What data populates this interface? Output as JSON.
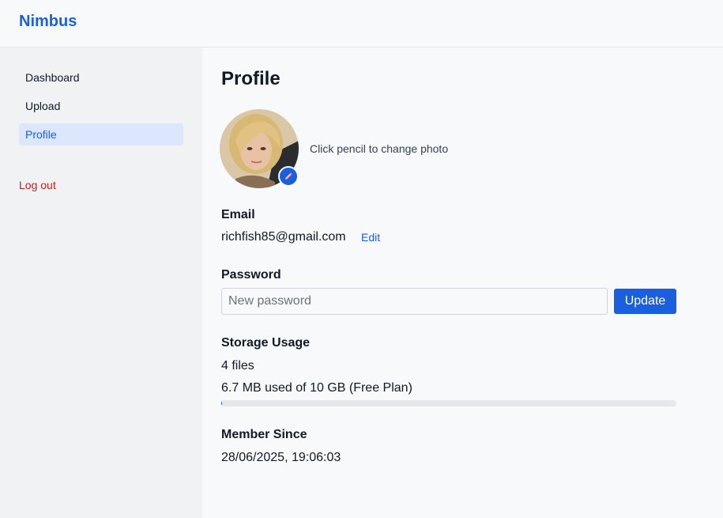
{
  "app": {
    "brand": "Nimbus"
  },
  "sidebar": {
    "items": [
      {
        "label": "Dashboard",
        "active": false
      },
      {
        "label": "Upload",
        "active": false
      },
      {
        "label": "Profile",
        "active": true
      }
    ],
    "logout_label": "Log out"
  },
  "profile": {
    "title": "Profile",
    "photo_hint": "Click pencil to change photo",
    "pencil_icon": "pencil-icon",
    "email_label": "Email",
    "email_value": "richfish85@gmail.com",
    "email_edit_label": "Edit",
    "password_label": "Password",
    "password_placeholder": "New password",
    "password_value": "",
    "update_label": "Update",
    "storage_label": "Storage Usage",
    "files_count": "4",
    "files_suffix": " files",
    "usage_text": "6.7 MB used of 10 GB (Free Plan)",
    "usage_fraction": 0.00067,
    "member_since_label": "Member Since",
    "member_since_value": "28/06/2025, 19:06:03"
  },
  "colors": {
    "accent": "#1a5fe0",
    "danger": "#c81e1e",
    "active_nav_bg": "#dbe7fd"
  }
}
